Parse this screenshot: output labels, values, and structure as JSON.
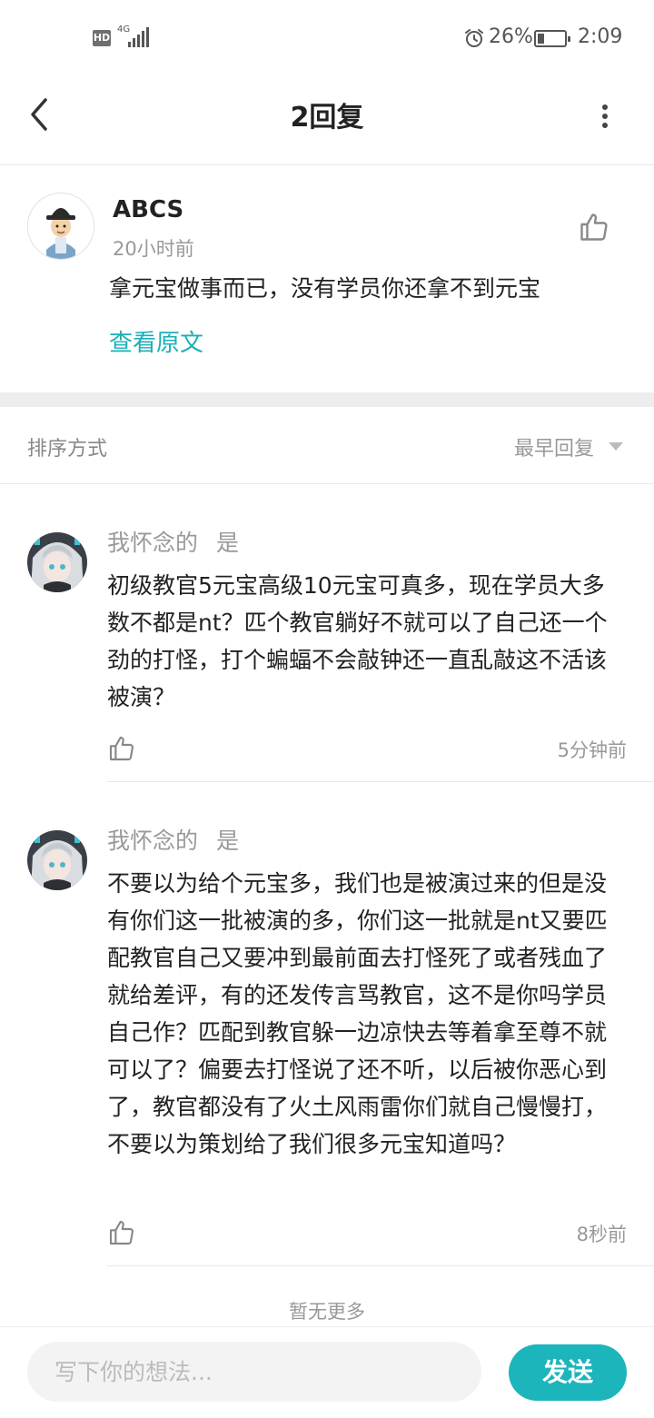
{
  "status_bar": {
    "hd": "HD",
    "network": "4G",
    "battery_percent": "26%",
    "battery_level": 0.26,
    "time": "2:09"
  },
  "header": {
    "title": "2回复",
    "back_icon": "chevron-left-icon",
    "more_icon": "more-vertical-icon"
  },
  "post": {
    "author": "ABCS",
    "time": "20小时前",
    "content": "拿元宝做事而已，没有学员你还拿不到元宝",
    "view_original": "查看原文",
    "like_icon": "thumb-up-icon"
  },
  "sort": {
    "label": "排序方式",
    "selected": "最早回复"
  },
  "replies": [
    {
      "author": "我怀念的",
      "tag": "是",
      "content": "初级教官5元宝高级10元宝可真多，现在学员大多数不都是nt？匹个教官躺好不就可以了自己还一个劲的打怪，打个蝙蝠不会敲钟还一直乱敲这不活该被演？",
      "time": "5分钟前"
    },
    {
      "author": "我怀念的",
      "tag": "是",
      "content": "不要以为给个元宝多，我们也是被演过来的但是没有你们这一批被演的多，你们这一批就是nt又要匹配教官自己又要冲到最前面去打怪死了或者残血了就给差评，有的还发传言骂教官，这不是你吗学员自己作？匹配到教官躲一边凉快去等着拿至尊不就可以了？偏要去打怪说了还不听，以后被你恶心到了，教官都没有了火土风雨雷你们就自己慢慢打，不要以为策划给了我们很多元宝知道吗？",
      "time": "8秒前"
    }
  ],
  "footer": {
    "no_more": "暂无更多",
    "input_placeholder": "写下你的想法...",
    "send_label": "发送"
  },
  "colors": {
    "accent": "#1aafb8",
    "send_button": "#1bb5bb"
  }
}
